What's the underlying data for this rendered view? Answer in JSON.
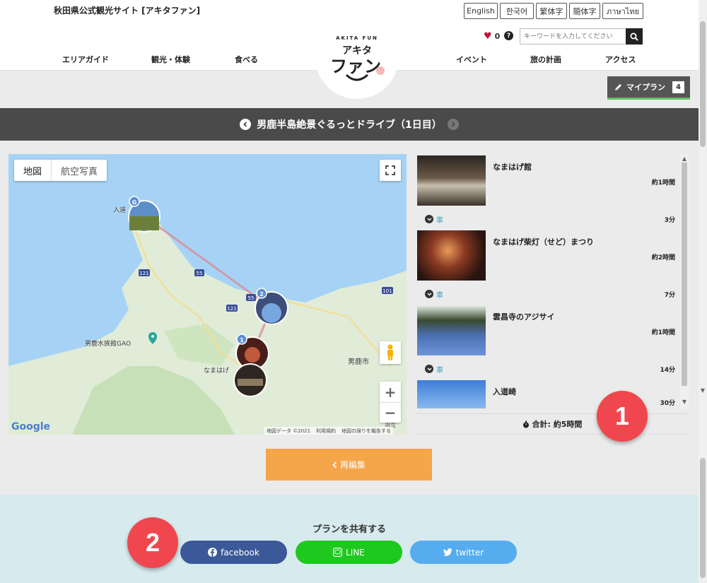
{
  "header": {
    "site_title": "秋田県公式観光サイト [アキタファン]",
    "languages": [
      "English",
      "한국어",
      "繁体字",
      "簡体字",
      "ภาษาไทย"
    ],
    "favorites_count": "0",
    "help_icon": "?",
    "search_placeholder": "キーワードを入力してください",
    "nav_left": [
      "エリアガイド",
      "観光・体験",
      "食べる"
    ],
    "nav_right": [
      "イベント",
      "旅の計画",
      "アクセス"
    ],
    "logo": {
      "top": "AKITA FUN",
      "mid": "アキタ",
      "main": "ファン"
    }
  },
  "myplan": {
    "label": "マイプラン",
    "count": "4"
  },
  "plan_title": "男鹿半島絶景ぐるっとドライブ（1日目）",
  "map": {
    "type_options": [
      "地図",
      "航空写真"
    ],
    "labels": {
      "nyudozaki": "入道",
      "aquarium": "男鹿水族館GAO",
      "oga_city": "男鹿市",
      "namahage": "なまはげ",
      "road_121a": "121",
      "road_55a": "55",
      "road_121b": "121",
      "road_55b": "55",
      "road_101": "101",
      "bottom_right": "羽立"
    },
    "markers": [
      "G",
      "2",
      "1",
      ""
    ],
    "footer": [
      "地図データ ©2021",
      "利用規約",
      "地図の誤りを報告する"
    ],
    "google": "Google"
  },
  "itinerary": {
    "spots": [
      {
        "name": "なまはげ館",
        "duration": "約1時間"
      },
      {
        "name": "なまはげ柴灯（せど）まつり",
        "duration": "約2時間"
      },
      {
        "name": "雲昌寺のアジサイ",
        "duration": "約1時間"
      },
      {
        "name": "入道崎",
        "duration": "30分"
      }
    ],
    "moves": [
      {
        "mode": "車",
        "time": "3分"
      },
      {
        "mode": "車",
        "time": "7分"
      },
      {
        "mode": "車",
        "time": "14分"
      }
    ],
    "total": "合計: 約5時間"
  },
  "edit_label": "再編集",
  "share": {
    "title": "プランを共有する",
    "facebook": "facebook",
    "line": "LINE",
    "twitter": "twitter"
  },
  "badges": [
    "1",
    "2"
  ]
}
